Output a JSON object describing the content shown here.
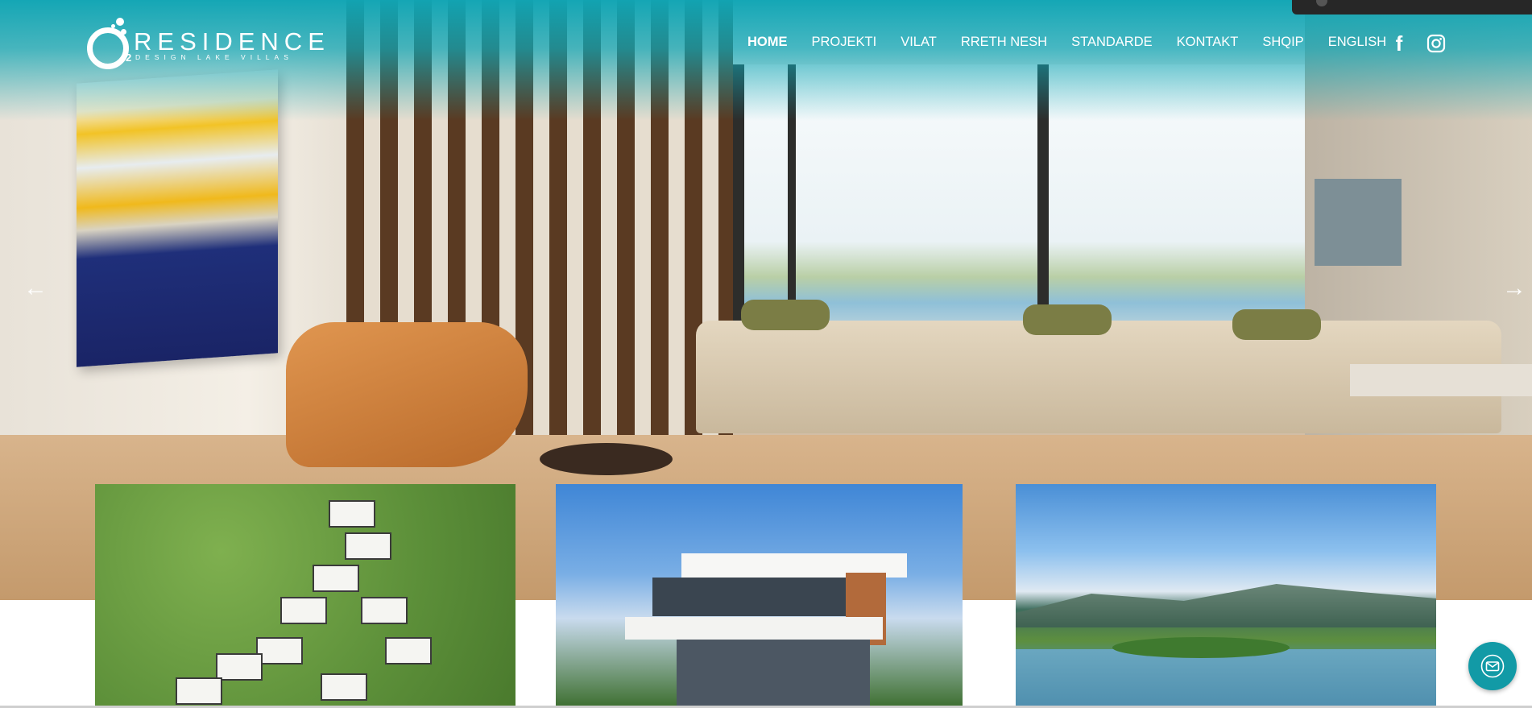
{
  "header": {
    "logo": {
      "wordmark": "RESIDENCE",
      "prefix_sub": "2",
      "tagline": "DESIGN LAKE VILLAS"
    },
    "nav": [
      {
        "label": "HOME",
        "active": true
      },
      {
        "label": "PROJEKTI",
        "active": false
      },
      {
        "label": "VILAT",
        "active": false
      },
      {
        "label": "RRETH NESH",
        "active": false
      },
      {
        "label": "STANDARDE",
        "active": false
      },
      {
        "label": "KONTAKT",
        "active": false
      },
      {
        "label": "SHQIP",
        "active": false
      },
      {
        "label": "ENGLISH",
        "active": false
      }
    ],
    "social": [
      "facebook-icon",
      "instagram-icon"
    ]
  },
  "slider": {
    "prev_label": "←",
    "next_label": "→"
  },
  "cards": [
    {
      "name": "aerial-development-image"
    },
    {
      "name": "villa-exterior-image"
    },
    {
      "name": "lake-landscape-image"
    }
  ],
  "contact_button": {
    "icon": "mail-icon"
  },
  "colors": {
    "brand_teal": "#10a5b4",
    "fab": "#129aa6",
    "text_on_teal": "#ffffff"
  }
}
